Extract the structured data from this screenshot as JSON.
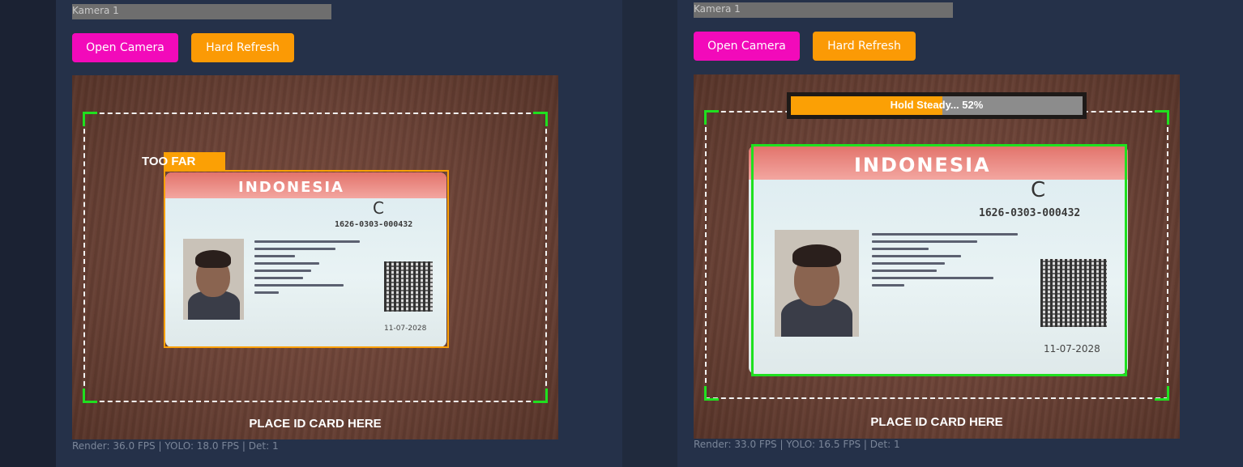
{
  "colors": {
    "page_bg": "#1b2233",
    "panel_bg": "#253149",
    "open_button": "#f20aba",
    "refresh_button": "#fb9a05",
    "guide_corner": "#1fe01f",
    "too_far_box": "#fba005",
    "detected_box": "#1fe01f",
    "progress_fill": "#fba005"
  },
  "cameras": [
    {
      "title": "Kamera 1",
      "open_label": "Open Camera",
      "refresh_label": "Hard Refresh",
      "status_tag": "TOO FAR",
      "place_text": "PLACE ID CARD HERE",
      "stats": "Render: 36.0 FPS | YOLO: 18.0 FPS | Det: 1",
      "card": {
        "country": "INDONESIA",
        "class": "C",
        "number": "1626-0303-000432",
        "expiry": "11-07-2028"
      }
    },
    {
      "title": "Kamera 1",
      "open_label": "Open Camera",
      "refresh_label": "Hard Refresh",
      "progress_label": "Hold Steady... 52%",
      "progress_value": 0.52,
      "place_text": "PLACE ID CARD HERE",
      "stats": "Render: 33.0 FPS | YOLO: 16.5 FPS | Det: 1",
      "card": {
        "country": "INDONESIA",
        "class": "C",
        "number": "1626-0303-000432",
        "expiry": "11-07-2028"
      }
    }
  ]
}
